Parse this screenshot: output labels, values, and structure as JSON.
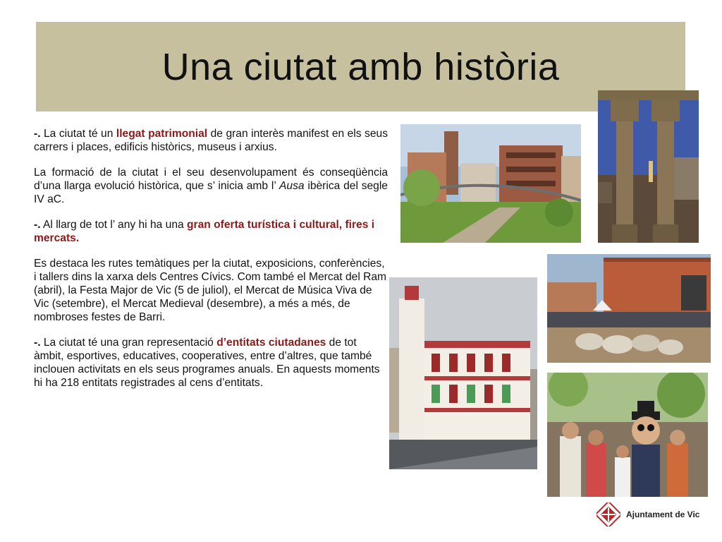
{
  "slide": {
    "title": "Una ciutat amb història"
  },
  "content": {
    "p1": {
      "bullet": "-.",
      "pre": " La ciutat té un ",
      "highlight": "llegat patrimonial",
      "post": " de gran interès manifest en els seus carrers i places, edificis històrics, museus i arxius."
    },
    "p2": {
      "text1": "La formació de la ciutat i el seu desenvolupament és conseqüència d’una llarga evolució històrica, que s’ inicia amb l’ ",
      "italic": "Ausa",
      "text2": " ibèrica del segle IV aC."
    },
    "p3": {
      "bullet": "-.",
      "pre": " Al llarg de tot l’ any hi ha una ",
      "highlight": "gran oferta turística i cultural, fires i mercats."
    },
    "p4": {
      "text": "Es destaca les rutes temàtiques per la ciutat, exposicions, conferències, i tallers dins la xarxa dels Centres Cívics. Com també el Mercat del Ram (abril), la Festa Major de Vic (5 de juliol), el Mercat de Música Viva de Vic (setembre), el Mercat Medieval (desembre), a més a més, de nombroses festes de Barri."
    },
    "p5": {
      "bullet": "-.",
      "pre": " La ciutat té una gran representació ",
      "highlight": "d’entitats ciutadanes",
      "post": " de tot àmbit, esportives, educatives, cooperatives, entre d’altres, que també inclouen activitats en els seus programes anuals. En aquests moments hi ha 218 entitats registrades al cens d’entitats."
    }
  },
  "footer": {
    "logo_text": "Ajuntament de Vic"
  },
  "colors": {
    "title_bar": "#c6c09f",
    "highlight": "#8b1a1a"
  }
}
